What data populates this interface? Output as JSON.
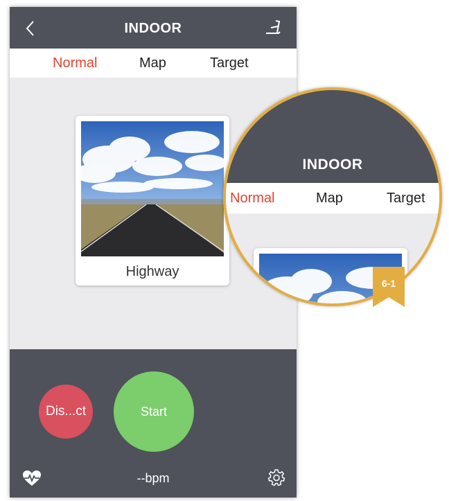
{
  "header": {
    "title": "INDOOR",
    "back_icon": "chevron-left-icon",
    "device_icon": "treadmill-icon"
  },
  "tabs": [
    {
      "label": "Normal",
      "active": true
    },
    {
      "label": "Map",
      "active": false
    },
    {
      "label": "Target",
      "active": false
    }
  ],
  "route_card": {
    "label": "Highway",
    "image": "highway-road-under-cloudy-sky"
  },
  "controls": {
    "disconnect_label": "Dis...ct",
    "start_label": "Start"
  },
  "footer": {
    "heart_icon": "heart-rate-icon",
    "bpm": "--bpm",
    "settings_icon": "gear-icon"
  },
  "callout": {
    "title": "INDOOR",
    "tabs": [
      "Normal",
      "Map",
      "Target"
    ],
    "badge": "6-1"
  },
  "colors": {
    "header_bg": "#4f525a",
    "active_tab": "#e8412c",
    "disconnect": "#d9505e",
    "start": "#7ccd6c",
    "callout_border": "#e3ad42"
  }
}
